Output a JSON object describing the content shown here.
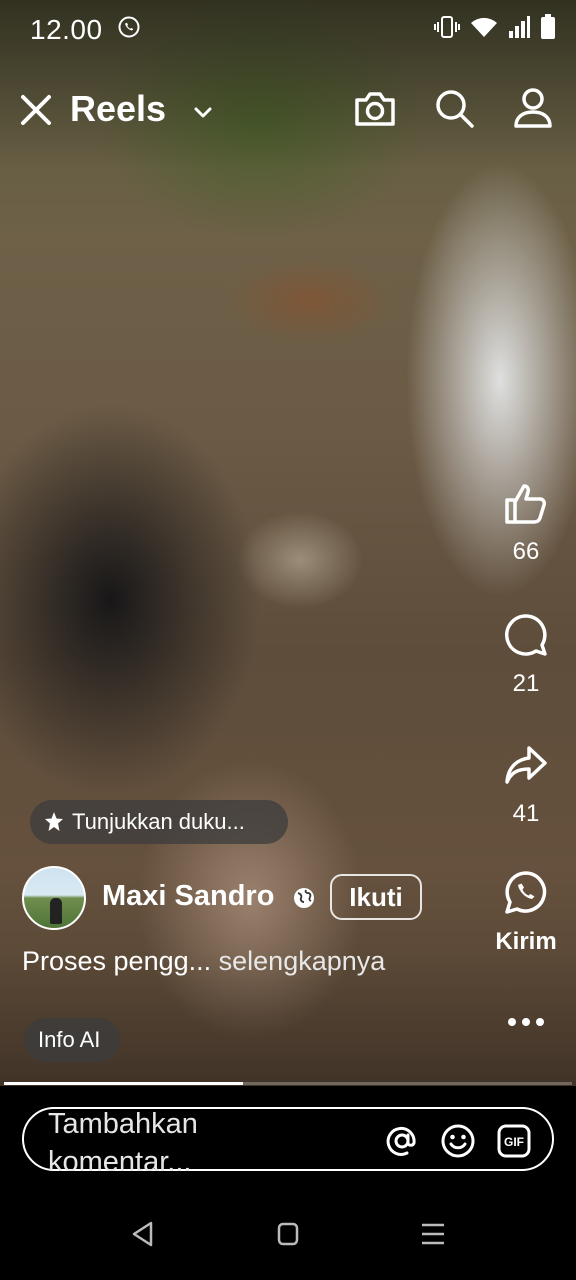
{
  "status_bar": {
    "time": "12.00"
  },
  "header": {
    "title": "Reels"
  },
  "actions": {
    "likes": "66",
    "comments": "21",
    "shares": "41",
    "send_label": "Kirim"
  },
  "chip": {
    "text": "Tunjukkan duku..."
  },
  "post": {
    "username": "Maxi Sandro",
    "follow_label": "Ikuti",
    "caption": "Proses pengg...",
    "see_more": "selengkapnya",
    "ai_info_label": "Info AI"
  },
  "video_progress": 0.42,
  "comment_box": {
    "placeholder": "Tambahkan komentar..."
  },
  "icons": [
    "whatsapp-icon",
    "vibrate-icon",
    "wifi-icon",
    "signal-icon",
    "battery-icon",
    "close-icon",
    "chevron-down-icon",
    "camera-icon",
    "search-icon",
    "profile-icon",
    "like-icon",
    "comment-icon",
    "share-icon",
    "whatsapp-send-icon",
    "more-icon",
    "sparkle-icon",
    "globe-icon",
    "mention-icon",
    "emoji-icon",
    "gif-icon",
    "nav-back-icon",
    "nav-home-icon",
    "nav-menu-icon"
  ]
}
